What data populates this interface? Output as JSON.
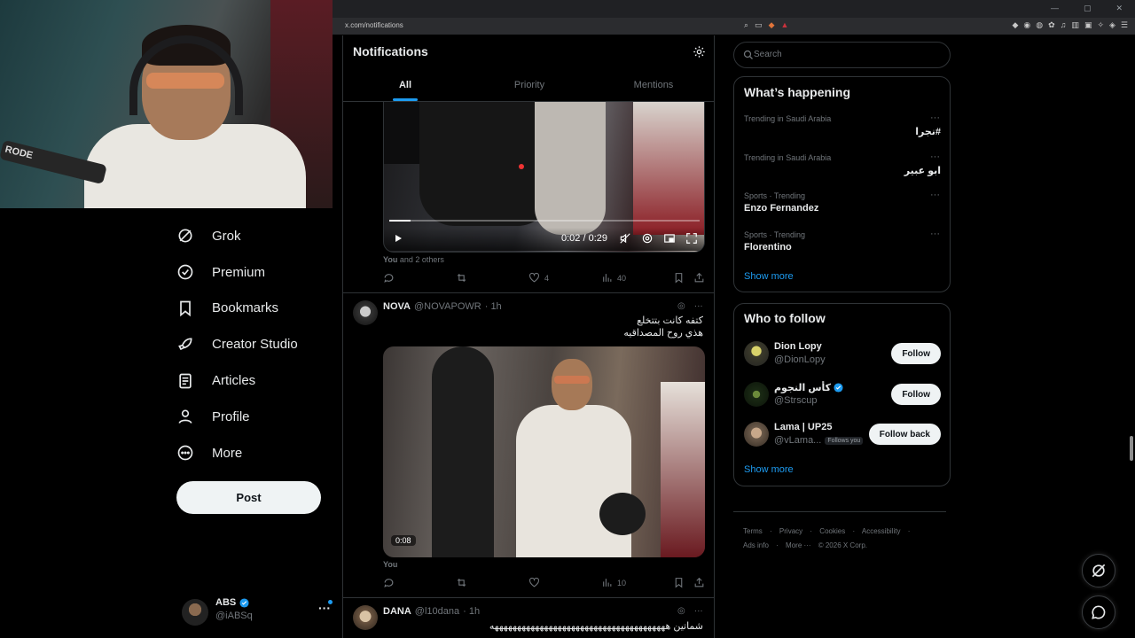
{
  "browser": {
    "url": "x.com/notifications"
  },
  "webcam": {
    "mic_label": "RODE"
  },
  "nav": {
    "items": [
      {
        "label": "Grok",
        "icon": "grok-icon"
      },
      {
        "label": "Premium",
        "icon": "premium-icon"
      },
      {
        "label": "Bookmarks",
        "icon": "bookmark-icon"
      },
      {
        "label": "Creator Studio",
        "icon": "rocket-icon"
      },
      {
        "label": "Articles",
        "icon": "articles-icon"
      },
      {
        "label": "Profile",
        "icon": "profile-icon"
      },
      {
        "label": "More",
        "icon": "more-circle-icon"
      }
    ],
    "post_label": "Post"
  },
  "account": {
    "name": "ABS",
    "handle": "@iABSq",
    "more": "···"
  },
  "main": {
    "title": "Notifications",
    "tabs": [
      "All",
      "Priority",
      "Mentions"
    ],
    "active_tab": "All",
    "video1": {
      "time": "0:02 / 0:29",
      "progress": 0.069
    },
    "tweet1_footer": {
      "you": "You",
      "others": "and 2 others"
    },
    "tweet1_actions": {
      "reply": "",
      "retweet": "",
      "likes": "4",
      "views": "40"
    },
    "tweet2": {
      "name": "NOVA",
      "handle": "@NOVAPOWR",
      "time": "· 1h",
      "line1": "كتفه كانت بتتخلع",
      "line2": "هذي روح المصداقيه",
      "video_time": "0:08",
      "footer": "You",
      "views": "10"
    },
    "tweet3": {
      "name": "DANA",
      "handle": "@l10dana",
      "time": "· 1h",
      "text": "شماتين هههههههههههههههههههههههههههههههههههههههه"
    }
  },
  "right": {
    "search_placeholder": "Search",
    "happening_title": "What’s happening",
    "trends": [
      {
        "meta": "Trending in Saudi Arabia",
        "name": "#نجرا",
        "rtl": true
      },
      {
        "meta": "Trending in Saudi Arabia",
        "name": "ابو عبير",
        "rtl": true
      },
      {
        "meta": "Sports · Trending",
        "name": "Enzo Fernandez",
        "rtl": false
      },
      {
        "meta": "Sports · Trending",
        "name": "Florentino",
        "rtl": false
      }
    ],
    "show_more": "Show more",
    "who_title": "Who to follow",
    "who": [
      {
        "name": "Dion Lopy",
        "handle": "@DionLopy",
        "button": "Follow",
        "verified": false,
        "follows_you": ""
      },
      {
        "name": "كأس النجوم",
        "handle": "@Strscup",
        "button": "Follow",
        "verified": true,
        "follows_you": ""
      },
      {
        "name": "Lama | UP25",
        "handle": "@vLama...",
        "button": "Follow back",
        "verified": false,
        "follows_you": "Follows you"
      }
    ],
    "footer_line1": [
      "Terms",
      "·",
      "Privacy",
      "·",
      "Cookies",
      "·",
      "Accessibility",
      "·"
    ],
    "footer_line2": [
      "Ads info",
      "·",
      "More ···",
      "© 2026 X Corp."
    ]
  },
  "colors": {
    "accent": "#1d9bf0",
    "background": "#000000",
    "border": "#2f3336",
    "muted": "#71767b"
  }
}
